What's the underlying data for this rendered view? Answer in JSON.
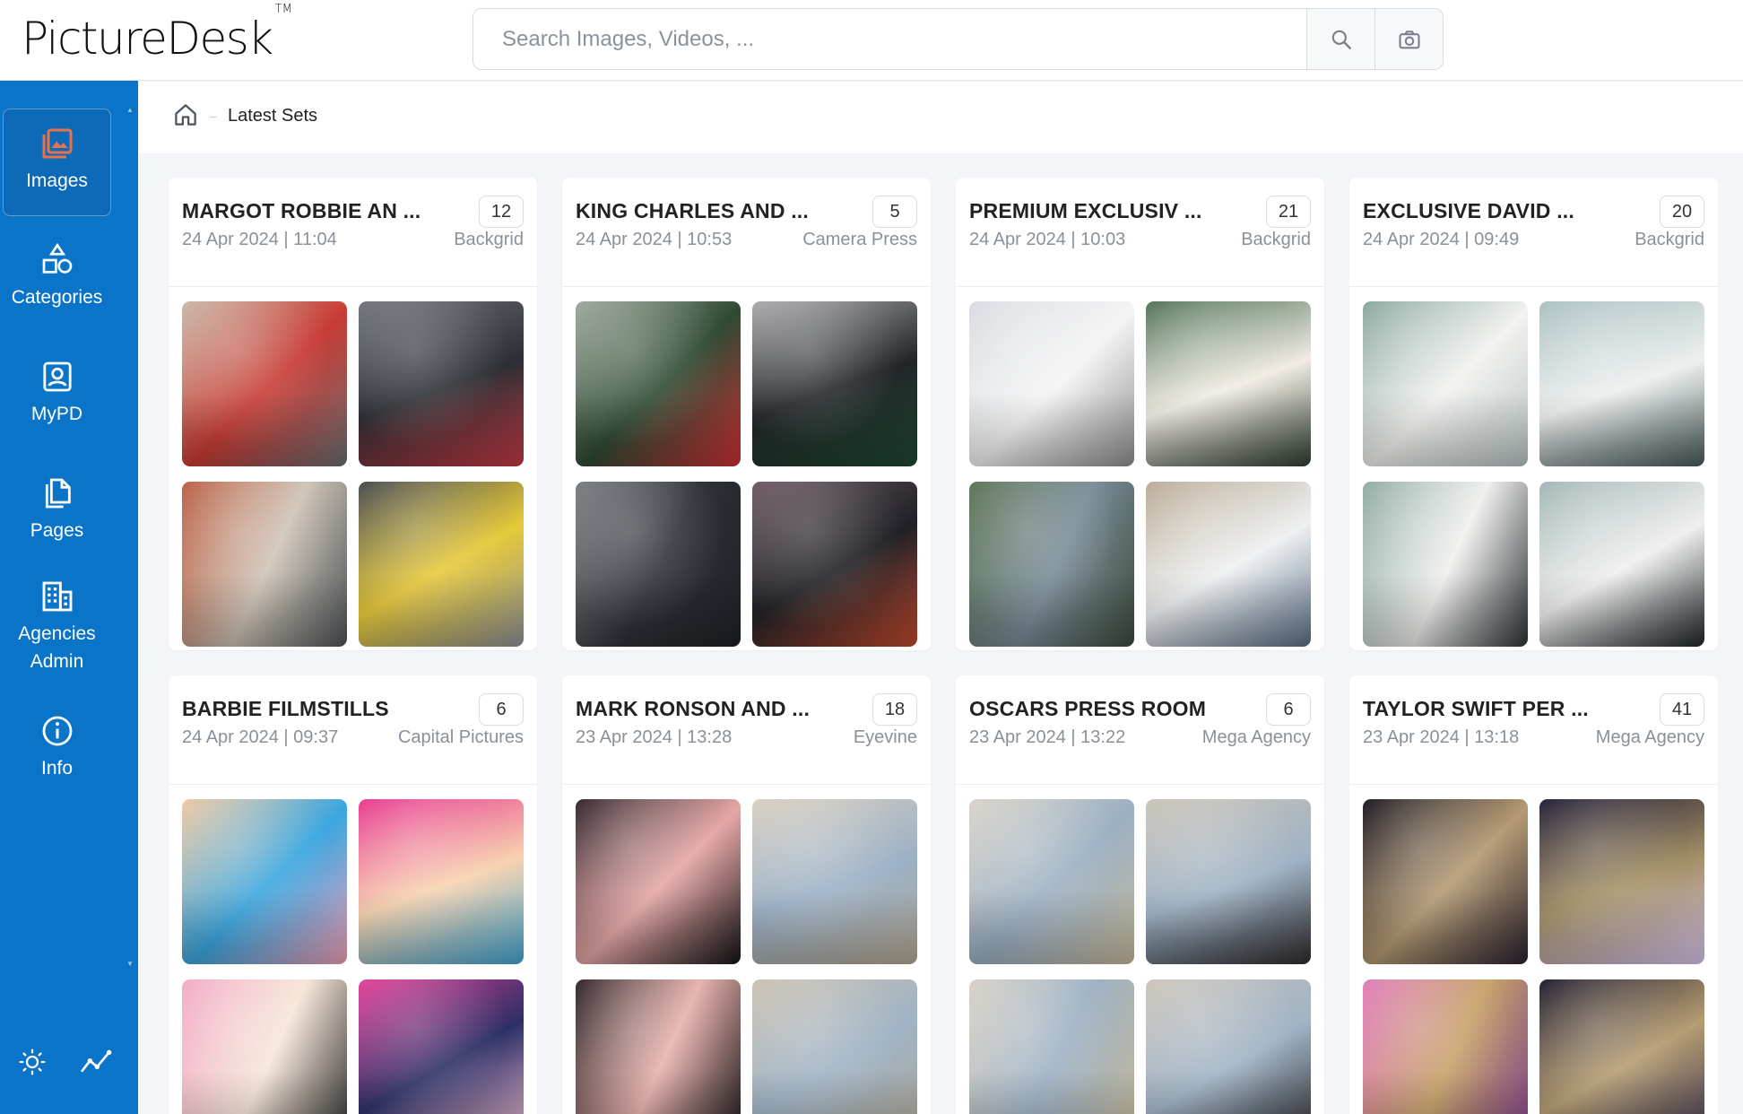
{
  "app": {
    "logo_text": "PictureDesk",
    "logo_tm": "TM"
  },
  "search": {
    "placeholder": "Search Images, Videos, ...",
    "value": "",
    "search_icon": "search-icon",
    "camera_icon": "camera-icon"
  },
  "sidebar": {
    "items": [
      {
        "label": "Images",
        "icon": "images-icon",
        "active": true
      },
      {
        "label": "Categories",
        "icon": "categories-icon",
        "active": false
      },
      {
        "label": "MyPD",
        "icon": "mypd-icon",
        "active": false
      },
      {
        "label": "Pages",
        "icon": "pages-icon",
        "active": false
      },
      {
        "label": "Agencies Admin",
        "icon": "agencies-icon",
        "active": false
      },
      {
        "label": "Info",
        "icon": "info-icon",
        "active": false
      }
    ],
    "bottom_icons": [
      "sun-icon",
      "analytics-icon"
    ]
  },
  "breadcrumb": {
    "home_icon": "home-icon",
    "current": "Latest Sets"
  },
  "colors": {
    "sidebar": "#0a74c9",
    "accent_icon": "#e8734a"
  },
  "sets": [
    {
      "title": "MARGOT ROBBIE AN ...",
      "count": "12",
      "date": "24 Apr 2024 | 11:04",
      "agency": "Backgrid",
      "thumb_colors": [
        [
          "#c9b6a4",
          "#c83b34",
          "#6b6f73"
        ],
        [
          "#6d7178",
          "#2b2e33",
          "#c73a45"
        ],
        [
          "#b95a3c",
          "#cfc4b6",
          "#4d5358"
        ],
        [
          "#414548",
          "#e6c93a",
          "#8f9296"
        ]
      ]
    },
    {
      "title": "KING CHARLES AND ...",
      "count": "5",
      "date": "24 Apr 2024 | 10:53",
      "agency": "Camera Press",
      "thumb_colors": [
        [
          "#9aa79b",
          "#2f4a32",
          "#cf2f34"
        ],
        [
          "#a9a9ab",
          "#232528",
          "#1e4a33"
        ],
        [
          "#777a7f",
          "#2d3136",
          "#1e2126"
        ],
        [
          "#6a5660",
          "#1f2126",
          "#c44a2f"
        ]
      ]
    },
    {
      "title": "PREMIUM EXCLUSIV ...",
      "count": "21",
      "date": "24 Apr 2024 | 10:03",
      "agency": "Backgrid",
      "thumb_colors": [
        [
          "#d7dbe0",
          "#f4f4f4",
          "#8f8f8f"
        ],
        [
          "#4c6e51",
          "#f1ece4",
          "#2e3d31"
        ],
        [
          "#58704f",
          "#7b8d99",
          "#3b4a3b"
        ],
        [
          "#b7a892",
          "#eef0f1",
          "#5b6f86"
        ]
      ]
    },
    {
      "title": "EXCLUSIVE DAVID ...",
      "count": "20",
      "date": "24 Apr 2024 | 09:49",
      "agency": "Backgrid",
      "thumb_colors": [
        [
          "#86a49b",
          "#f2f2f0",
          "#b8c3c1"
        ],
        [
          "#a8bec0",
          "#ecefee",
          "#475a59"
        ],
        [
          "#8ba89f",
          "#f0f0ee",
          "#2d3437"
        ],
        [
          "#9fb4b3",
          "#efefee",
          "#1d2427"
        ]
      ]
    },
    {
      "title": "BARBIE FILMSTILLS",
      "count": "6",
      "date": "24 Apr 2024 | 09:37",
      "agency": "Capital Pictures",
      "thumb_colors": [
        [
          "#f1c7a0",
          "#3aa7e0",
          "#f4a1b9"
        ],
        [
          "#e8338d",
          "#f7d3b0",
          "#41a7d6"
        ],
        [
          "#f2a7c4",
          "#f6e6d8",
          "#2d2d2d"
        ],
        [
          "#e43b97",
          "#2c2f66",
          "#f5c0d3"
        ]
      ]
    },
    {
      "title": "MARK RONSON AND ...",
      "count": "18",
      "date": "23 Apr 2024 | 13:28",
      "agency": "Eyevine",
      "thumb_colors": [
        [
          "#2b1f25",
          "#e7a7a7",
          "#141416"
        ],
        [
          "#d7cdbe",
          "#9bb1c7",
          "#b5a894"
        ],
        [
          "#2a1f22",
          "#e8b2ad",
          "#161517"
        ],
        [
          "#c9bfae",
          "#9fb3c6",
          "#b1a691"
        ]
      ]
    },
    {
      "title": "OSCARS PRESS ROOM",
      "count": "6",
      "date": "23 Apr 2024 | 13:22",
      "agency": "Mega Agency",
      "thumb_colors": [
        [
          "#d8d2c6",
          "#9bb0c4",
          "#c6ba9c"
        ],
        [
          "#c9c2b6",
          "#9eb2c5",
          "#2f2b2d"
        ],
        [
          "#d7d0c3",
          "#9cb1c5",
          "#c4b89a"
        ],
        [
          "#cbc4b8",
          "#a0b3c6",
          "#2d2a2c"
        ]
      ]
    },
    {
      "title": "TAYLOR SWIFT PER ...",
      "count": "41",
      "date": "23 Apr 2024 | 13:18",
      "agency": "Mega Agency",
      "thumb_colors": [
        [
          "#15121a",
          "#b59a74",
          "#2a2230"
        ],
        [
          "#1c1830",
          "#a59066",
          "#d9c7f0"
        ],
        [
          "#e079b8",
          "#c7a369",
          "#7e3f8a"
        ],
        [
          "#1b1828",
          "#b69c72",
          "#3a3453"
        ]
      ]
    }
  ]
}
